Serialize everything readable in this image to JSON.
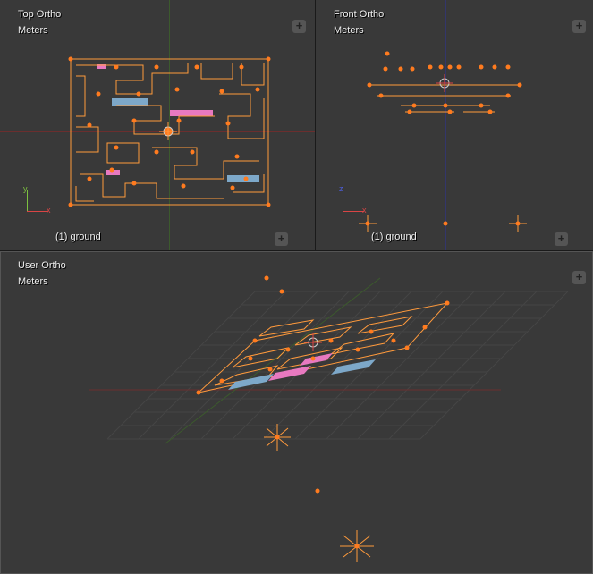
{
  "viewports": {
    "top_left": {
      "view_label": "Top Ortho",
      "units_label": "Meters",
      "object_label": "(1) ground",
      "axis1": {
        "label": "y",
        "color": "#7cc040"
      },
      "axis2": {
        "label": "x",
        "color": "#d94545"
      }
    },
    "top_right": {
      "view_label": "Front Ortho",
      "units_label": "Meters",
      "object_label": "(1) ground",
      "axis1": {
        "label": "z",
        "color": "#4e5fe0"
      },
      "axis2": {
        "label": "x",
        "color": "#d94545"
      }
    },
    "bottom": {
      "view_label": "User Ortho",
      "units_label": "Meters"
    }
  },
  "colors": {
    "bg": "#393939",
    "edge": "#ff9a3c",
    "vertex": "#ff7b1f",
    "pink": "#e879c0",
    "blue": "#7da8c9",
    "axis_x": "#6b2e2e",
    "axis_y": "#3c5a2d",
    "axis_z": "#33366b",
    "grid": "#474747"
  },
  "icons": {
    "plus": "+"
  }
}
